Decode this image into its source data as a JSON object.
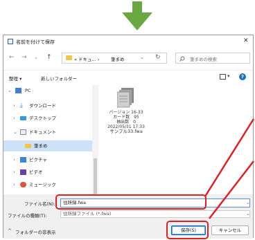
{
  "window": {
    "title": "名前を付けて保存",
    "close": "✕"
  },
  "nav": {
    "back": "←",
    "forward": "→",
    "dropdown": "⌄",
    "up": "↑",
    "breadcrumb_prefix": "« ドキュ... ›",
    "breadcrumb_current": "筆まめ",
    "refresh": "↻",
    "search_placeholder": "筆まめの検索"
  },
  "toolbar": {
    "organize": "整理 ▾",
    "new_folder": "新しいフォルダー",
    "help": "?"
  },
  "sidebar": {
    "items": [
      {
        "label": "PC"
      },
      {
        "label": "ダウンロード"
      },
      {
        "label": "デスクトップ"
      },
      {
        "label": "ドキュメント"
      },
      {
        "label": "筆まめ"
      },
      {
        "label": "ピクチャ"
      },
      {
        "label": "ビデオ"
      },
      {
        "label": "ミュージック"
      }
    ]
  },
  "file": {
    "lines": [
      "バージョン 16-33",
      "カード数　95",
      "抽出数　0",
      "2022/05/31 17:33",
      "サンプル33.fwa"
    ]
  },
  "form": {
    "filename_label": "ファイル名(N):",
    "filename_value": "住所録.fwa",
    "filetype_label": "ファイルの種類(T):",
    "filetype_value": "住所録ファイル (*.fwa)"
  },
  "footer": {
    "hide_folders": "フォルダーの非表示",
    "save_button": "保存(S)",
    "cancel_button": "キャンセル"
  },
  "colors": {
    "arrow": "#6aa842",
    "highlight": "#e02020",
    "accent": "#0067c0"
  }
}
